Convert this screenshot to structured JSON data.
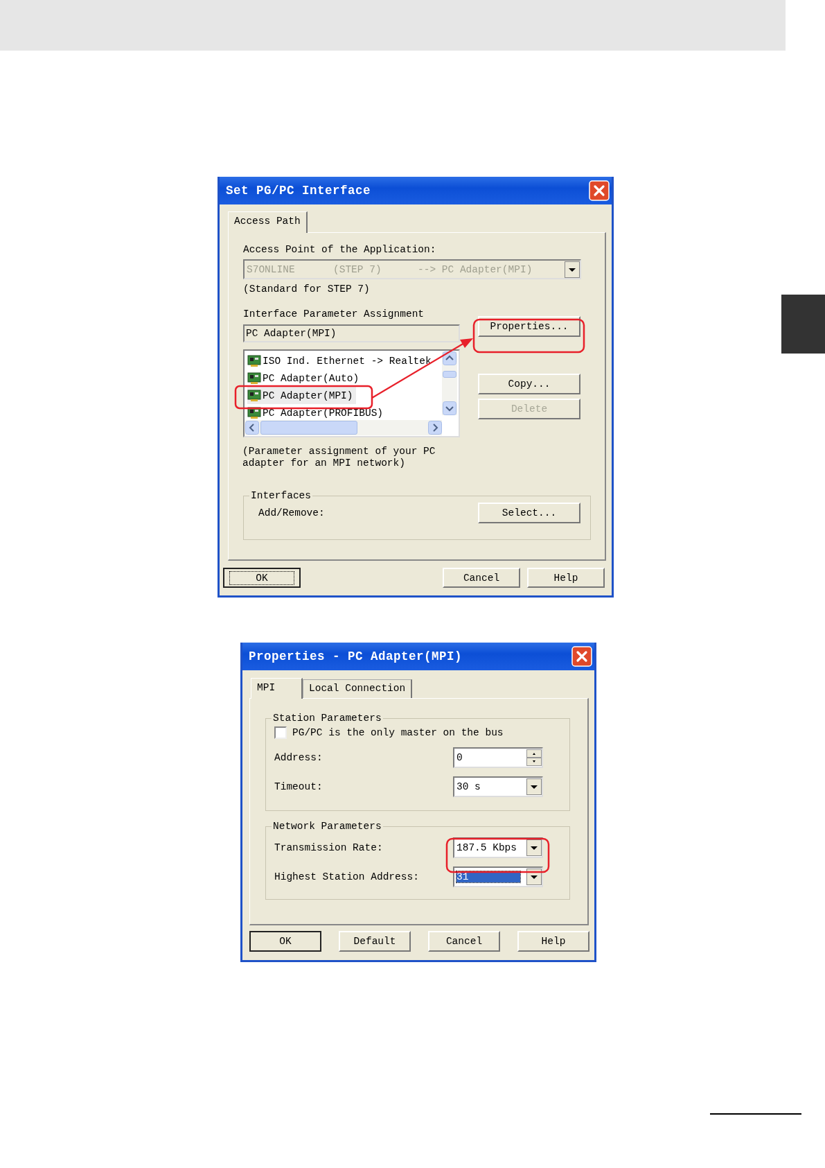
{
  "interface_dialog": {
    "title": "Set PG/PC Interface",
    "tabs": [
      {
        "label": "Access Path",
        "selected": true
      }
    ],
    "access_point": {
      "label": "Access Point of the Application:",
      "value": [
        "S7ONLINE",
        "(STEP 7)",
        "--> PC Adapter(MPI)"
      ],
      "disabled": true
    },
    "access_note": "(Standard for STEP 7)",
    "assignment": {
      "label": "Interface Parameter Assignment",
      "value": "PC Adapter(MPI)"
    },
    "adapters": [
      {
        "label": "ISO Ind. Ethernet -> Realtek",
        "selected": false
      },
      {
        "label": "PC Adapter(Auto)",
        "selected": false
      },
      {
        "label": "PC Adapter(MPI)",
        "selected": true
      },
      {
        "label": "PC Adapter(PROFIBUS)",
        "selected": false
      }
    ],
    "side_buttons": [
      {
        "label": "Properties...",
        "disabled": false
      },
      {
        "label": "Copy...",
        "disabled": false
      },
      {
        "label": "Delete",
        "disabled": true
      }
    ],
    "description": "(Parameter assignment of your PC adapter for an MPI network)",
    "interfaces": {
      "legend": "Interfaces",
      "label": "Add/Remove:",
      "button": "Select..."
    },
    "buttons": [
      {
        "label": "OK",
        "focused": true
      },
      {
        "label": "Cancel",
        "focused": false
      },
      {
        "label": "Help",
        "focused": false
      }
    ]
  },
  "properties_dialog": {
    "title": "Properties - PC Adapter(MPI)",
    "tabs": [
      {
        "label": "MPI",
        "selected": true
      },
      {
        "label": "Local Connection",
        "selected": false
      }
    ],
    "station": {
      "legend": "Station Parameters",
      "only_master": {
        "label": "PG/PC is the only master on the bus",
        "checked": false
      },
      "address": {
        "label": "Address:",
        "value": "0"
      },
      "timeout": {
        "label": "Timeout:",
        "value": "30 s"
      }
    },
    "network": {
      "legend": "Network Parameters",
      "rate": {
        "label": "Transmission Rate:",
        "value": "187.5 Kbps",
        "selected": false
      },
      "highest": {
        "label": "Highest Station Address:",
        "value": "31",
        "selected": true
      }
    },
    "buttons": [
      {
        "label": "OK",
        "focused": true
      },
      {
        "label": "Default",
        "focused": false
      },
      {
        "label": "Cancel",
        "focused": false
      },
      {
        "label": "Help",
        "focused": false
      }
    ]
  }
}
